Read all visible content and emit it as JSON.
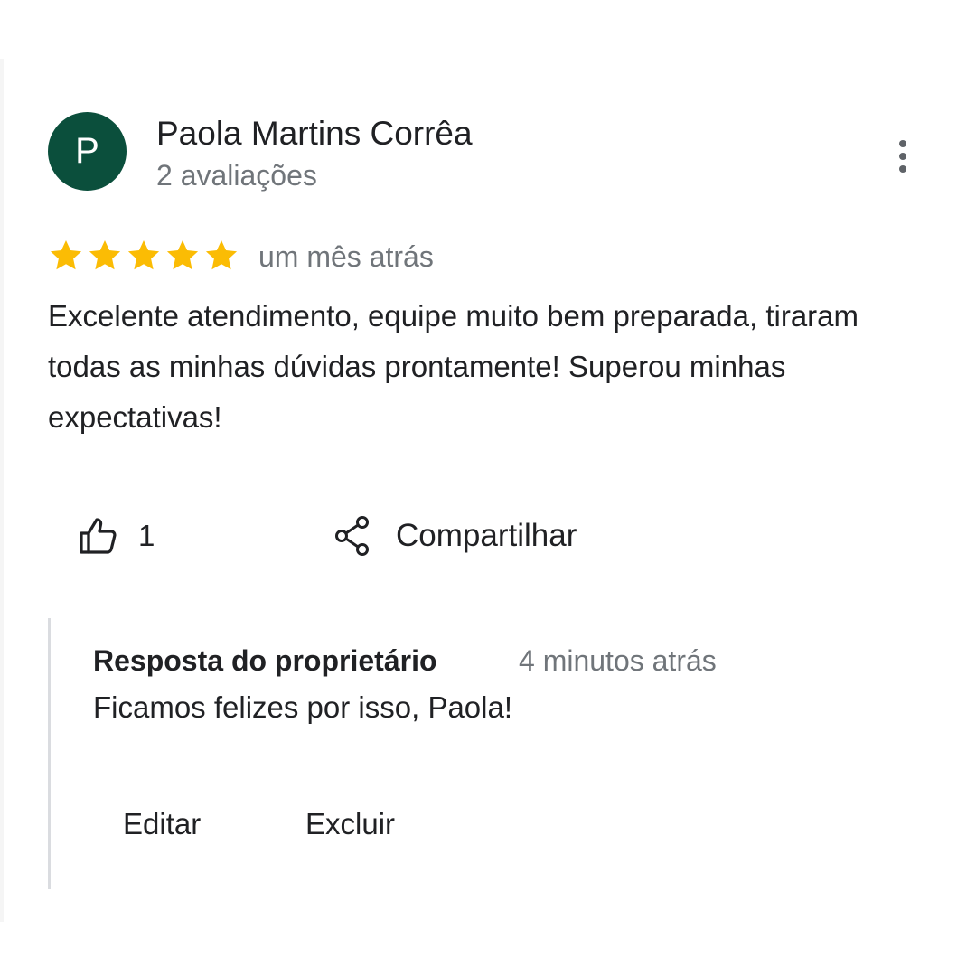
{
  "review": {
    "avatar_letter": "P",
    "avatar_color": "#0b4f3c",
    "reviewer_name": "Paola Martins Corrêa",
    "reviewer_review_count": "2 avaliações",
    "more_options_icon": "more-vert-icon",
    "rating": 5,
    "rating_max": 5,
    "star_color": "#fbbc04",
    "date": "um mês atrás",
    "text": "Excelente atendimento, equipe muito bem preparada, tiraram todas as minhas dúvidas prontamente! Superou minhas expectativas!",
    "like_icon": "thumb-up-icon",
    "like_count": "1",
    "share_icon": "share-icon",
    "share_label": "Compartilhar"
  },
  "owner_reply": {
    "title": "Resposta do proprietário",
    "time": "4 minutos atrás",
    "text": "Ficamos felizes por isso, Paola!",
    "edit_label": "Editar",
    "delete_label": "Excluir"
  }
}
